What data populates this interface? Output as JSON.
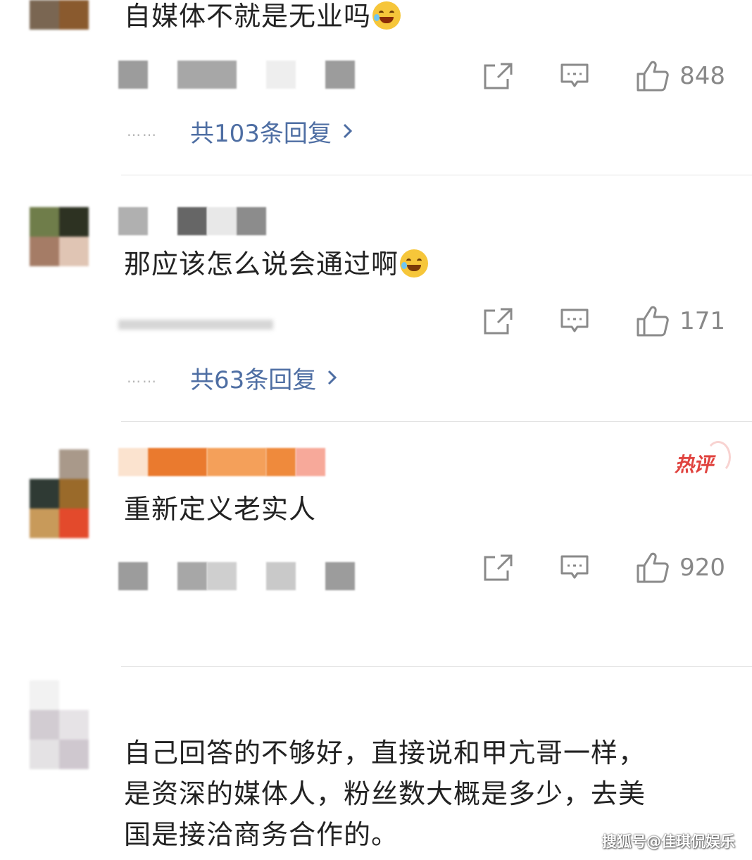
{
  "comments": [
    {
      "text": "自媒体不就是无业吗",
      "emoji": "laughing-tears",
      "likes": "848",
      "replies_label": "共103条回复",
      "hot": false
    },
    {
      "text": "那应该怎么说会通过啊",
      "emoji": "crying-laugh",
      "likes": "171",
      "replies_label": "共63条回复",
      "hot": false
    },
    {
      "text": "重新定义老实人",
      "likes": "920",
      "hot": true,
      "hot_label": "热评"
    },
    {
      "text_lines": [
        "自己回答的不够好，直接说和甲亢哥一样，",
        "是资深的媒体人，粉丝数大概是多少，去美",
        "国是接洽商务合作的。"
      ]
    }
  ],
  "reply_dots": "……",
  "watermark": "搜狐号@佳琪侃娱乐",
  "colors": {
    "link": "#4e6ea3",
    "hot": "#e0433f",
    "muted": "#888888",
    "divider": "#e3e3e3"
  }
}
